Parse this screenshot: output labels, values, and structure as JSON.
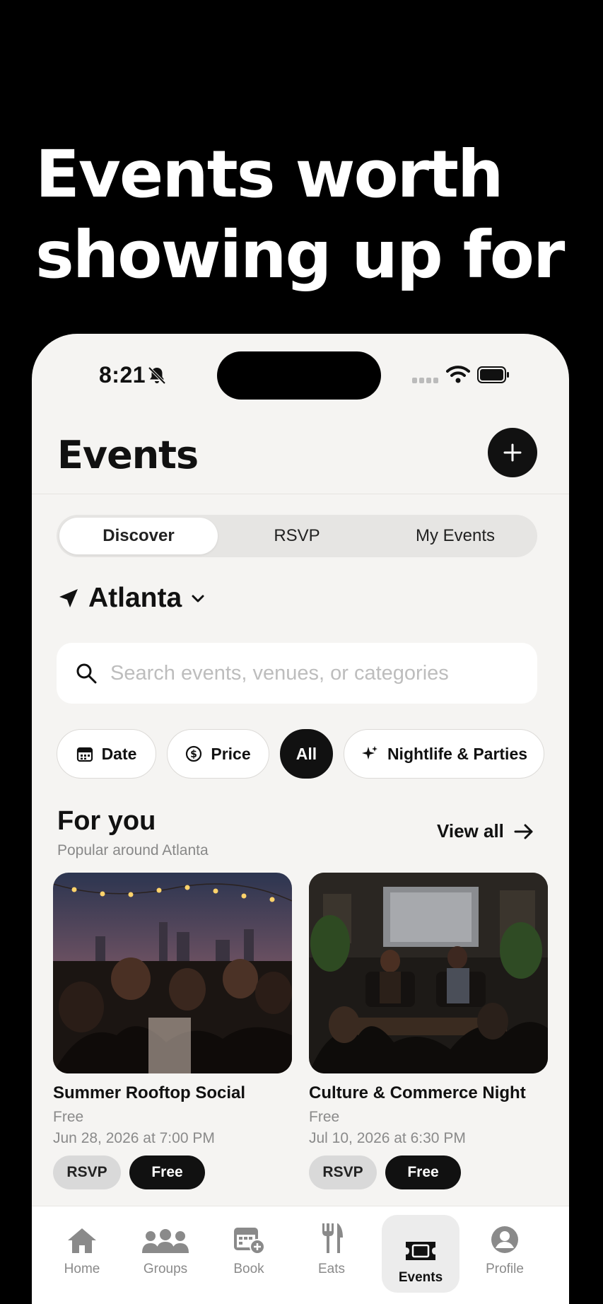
{
  "headline": {
    "line1": "Events worth",
    "line2": "showing up for"
  },
  "status_bar": {
    "time": "8:21"
  },
  "header": {
    "title": "Events"
  },
  "segments": [
    "Discover",
    "RSVP",
    "My Events"
  ],
  "location": {
    "city": "Atlanta"
  },
  "search": {
    "placeholder": "Search events, venues, or categories"
  },
  "filters": {
    "date": "Date",
    "price": "Price",
    "all": "All",
    "category": "Nightlife & Parties"
  },
  "section": {
    "title": "For you",
    "subtitle": "Popular around Atlanta",
    "view_all": "View all"
  },
  "events": [
    {
      "name": "Summer Rooftop Social",
      "price": "Free",
      "date": "Jun 28, 2026 at 7:00 PM",
      "rsvp_label": "RSVP",
      "badge": "Free"
    },
    {
      "name": "Culture & Commerce Night",
      "price": "Free",
      "date": "Jul 10, 2026 at 6:30 PM",
      "rsvp_label": "RSVP",
      "badge": "Free"
    }
  ],
  "tabbar": [
    "Home",
    "Groups",
    "Book",
    "Eats",
    "Events",
    "Profile"
  ],
  "colors": {
    "background": "#000000",
    "app_background": "#f5f4f2",
    "accent": "#111111",
    "muted_text": "#8a8a8a"
  }
}
